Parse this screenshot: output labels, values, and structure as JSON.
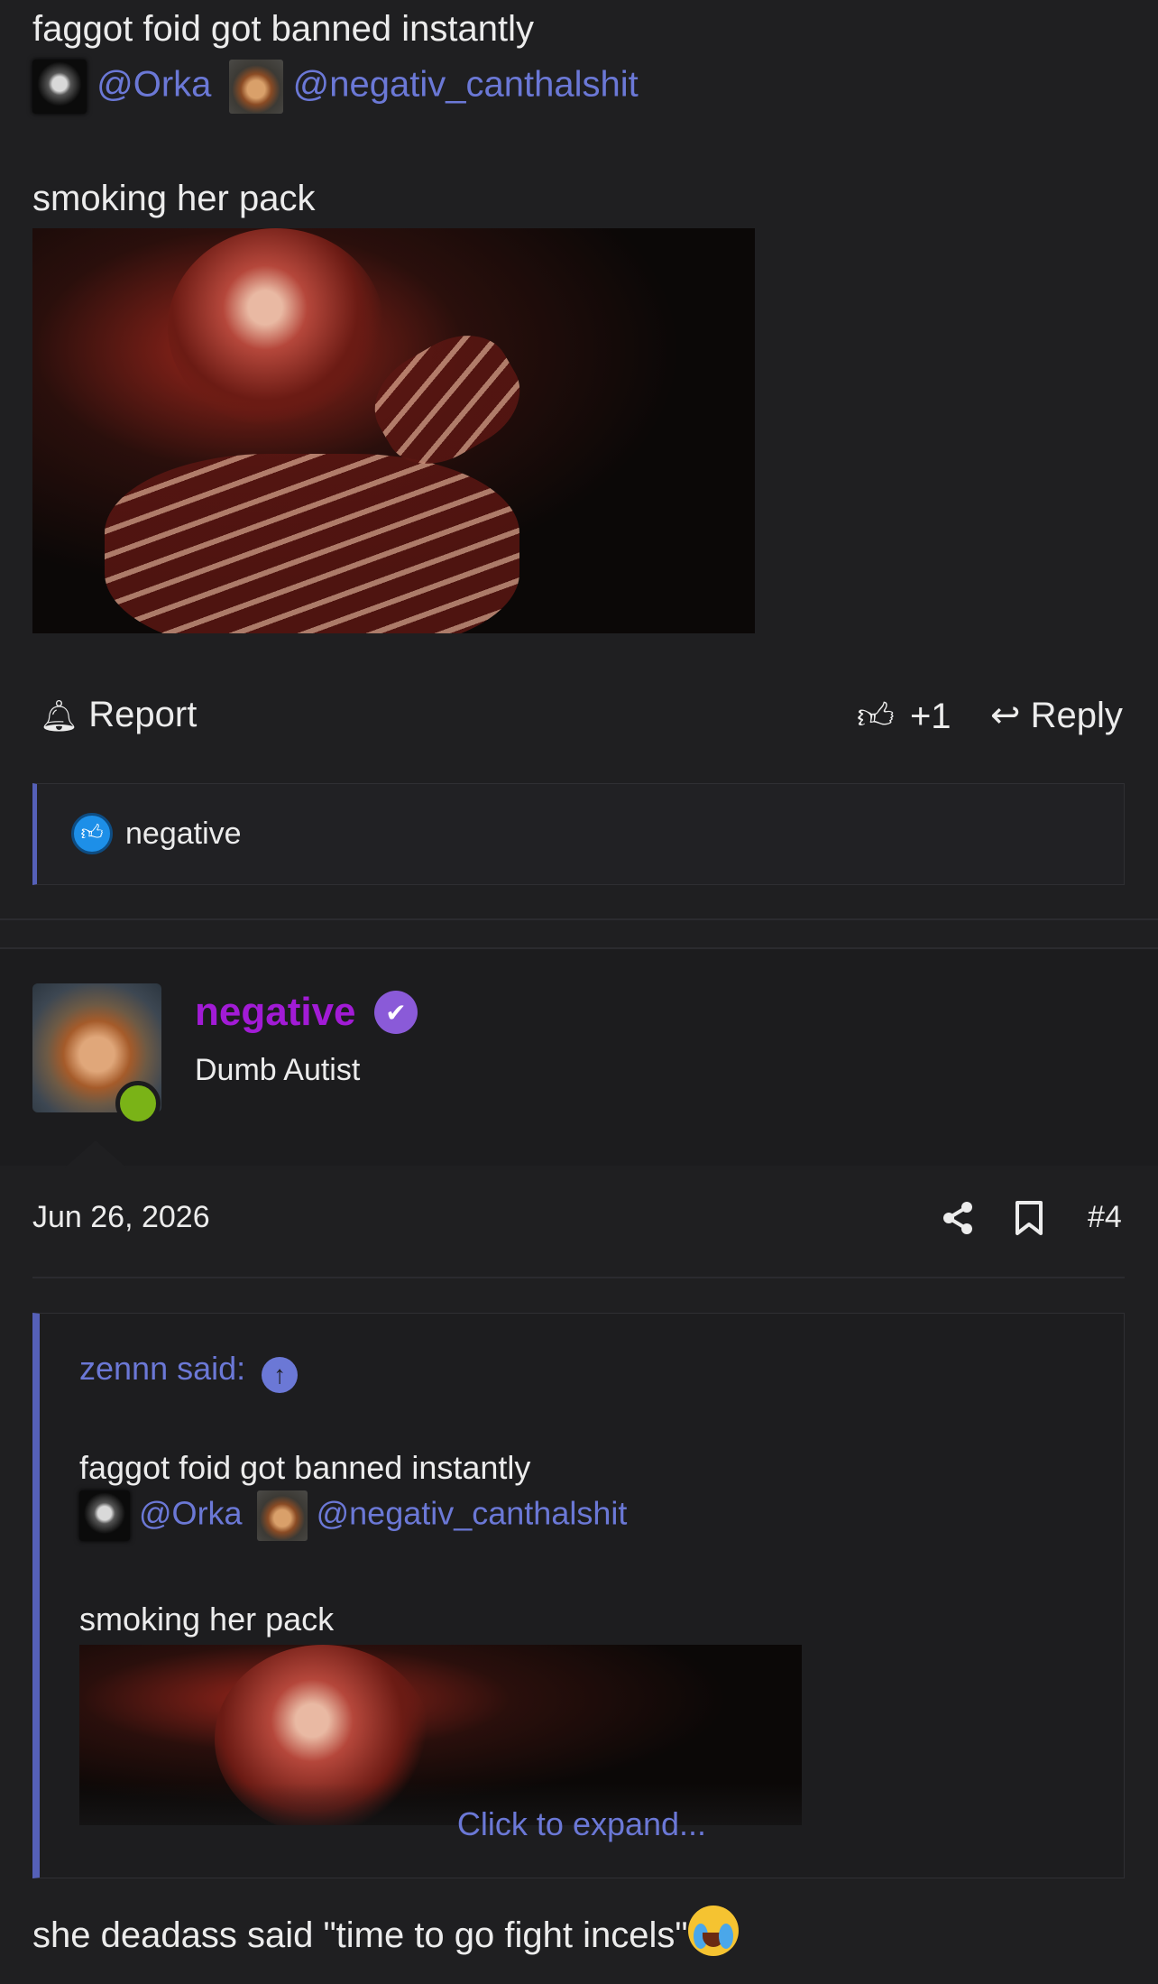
{
  "post_top": {
    "line1": "faggot foid got banned instantly",
    "mention1": "@Orka",
    "mention2": "@negativ_canthalshit",
    "caption": "smoking her pack",
    "actions": {
      "report_label": "Report",
      "like_count": "+1",
      "reply_label": "Reply"
    },
    "reaction_user": "negative"
  },
  "post4": {
    "username": "negative",
    "user_title": "Dumb Autist",
    "date": "Jun 26, 2026",
    "post_number": "#4",
    "quote": {
      "author_label": "zennn said:",
      "line1": "faggot foid got banned instantly",
      "mention1": "@Orka",
      "mention2": "@negativ_canthalshit",
      "caption": "smoking her pack",
      "expand_label": "Click to expand..."
    },
    "reply_text": "she deadass said \"time to go fight incels\""
  },
  "icons": {
    "report": "bell-icon",
    "like": "thumbs-up-icon",
    "reply": "reply-arrow-icon",
    "verified": "checkmark-badge-icon",
    "share": "share-icon",
    "bookmark": "bookmark-icon",
    "quote_jump": "arrow-up-circle-icon",
    "emoji": "crying-laughing-emoji-icon"
  },
  "colors": {
    "background": "#1f1f21",
    "mention": "#6b78d6",
    "username": "#a21bd6",
    "online": "#7ab317",
    "accent_border": "#5560b8"
  }
}
